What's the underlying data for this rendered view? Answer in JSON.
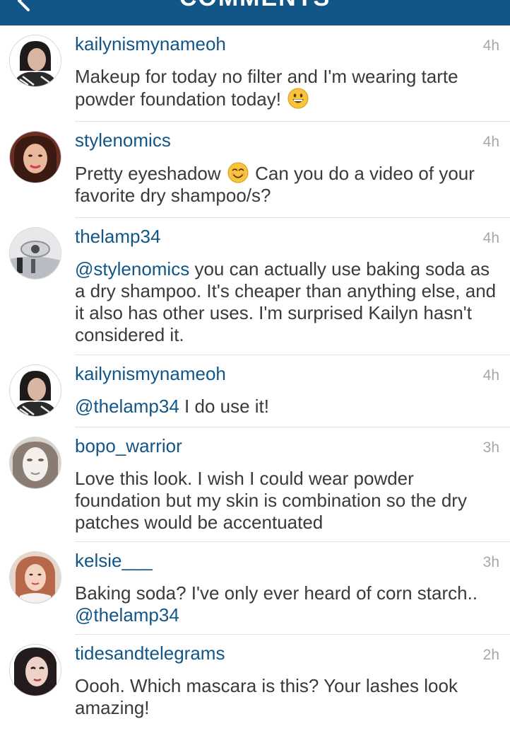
{
  "header": {
    "title": "COMMENTS"
  },
  "comments": [
    {
      "username": "kailynismynameoh",
      "time": "4h",
      "text": "Makeup for today no filter and I'm wearing tarte powder foundation today!",
      "emoji": "grinning-face-emoji"
    },
    {
      "username": "stylenomics",
      "time": "4h",
      "text_before": "Pretty eyeshadow",
      "emoji": "smiling-face-emoji",
      "text_after": "Can you do a video of your favorite dry shampoo/s?"
    },
    {
      "username": "thelamp34",
      "time": "4h",
      "mention": "@stylenomics",
      "text": "you can actually use baking soda as a dry shampoo. It's cheaper than anything else, and it also has other uses. I'm surprised Kailyn hasn't considered it."
    },
    {
      "username": "kailynismynameoh",
      "time": "4h",
      "mention": "@thelamp34",
      "text": "I do use it!"
    },
    {
      "username": "bopo_warrior",
      "time": "3h",
      "text": "Love this look. I wish I could wear powder foundation but my skin is combination so the dry patches would be accentuated"
    },
    {
      "username": "kelsie___",
      "time": "3h",
      "text": "Baking soda? I've only ever heard of corn starch..",
      "mention": "@thelamp34"
    },
    {
      "username": "tidesandtelegrams",
      "time": "2h",
      "text": "Oooh. Which mascara is this? Your lashes look amazing!"
    }
  ],
  "colors": {
    "header_bg": "#125688",
    "username": "#125688",
    "body_text": "#3a3a3a",
    "timestamp": "#a7a7a7"
  }
}
